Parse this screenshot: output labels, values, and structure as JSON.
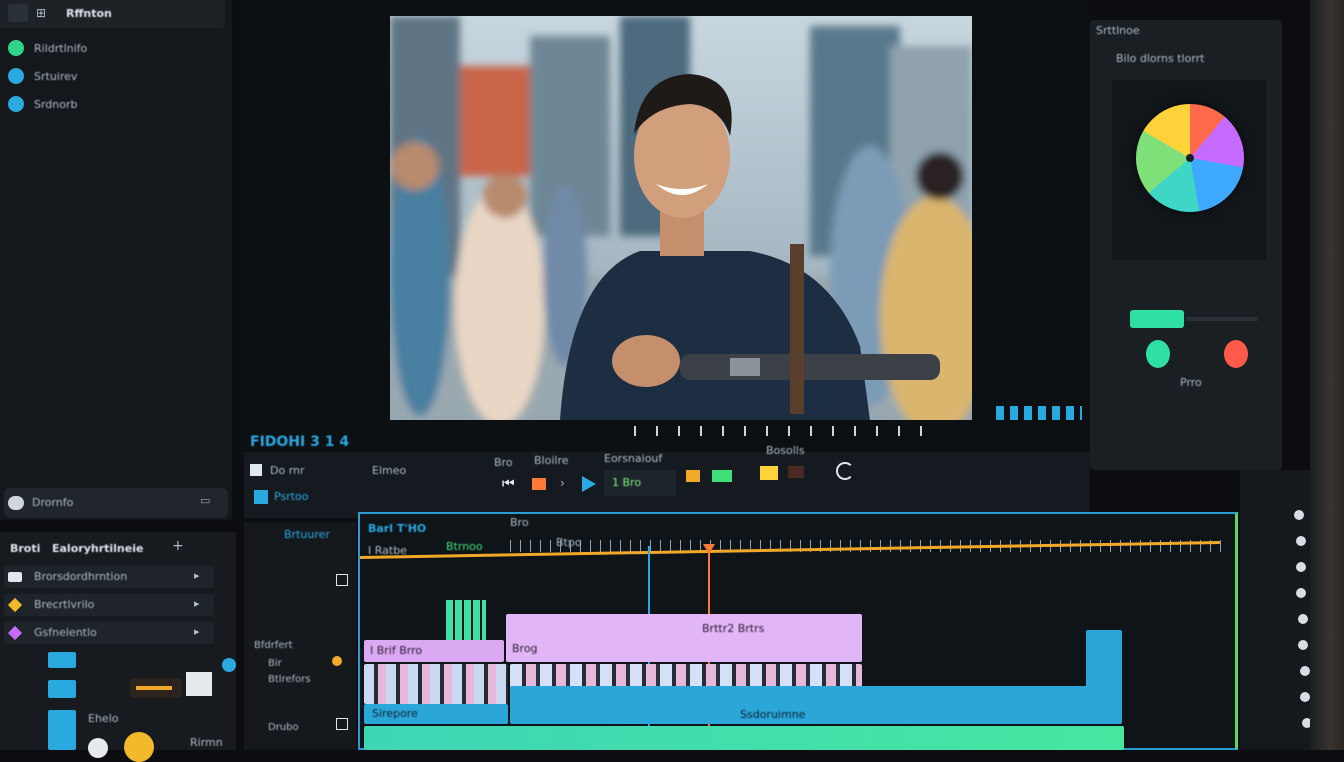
{
  "left_panel": {
    "title": "Rffnton",
    "items": [
      {
        "label": "Rildrtlnifo",
        "color": "#2fd38a"
      },
      {
        "label": "Srtuirev",
        "color": "#2aa8e0"
      },
      {
        "label": "Srdnorb",
        "color": "#2aa8e0"
      }
    ],
    "footer_label": "Drornfo"
  },
  "left_bottom": {
    "header": "Broti",
    "header_title": "Ealoryhrtilneie",
    "rows": [
      "Brorsdordhrntion",
      "Brecrtlvrilo",
      "Gsfnelentlo"
    ],
    "bottom_items": [
      "Ehelo",
      "Rirmn"
    ]
  },
  "viewer": {
    "timecode_label": "FIDOHI 3 1 4",
    "transport_left": [
      "Do rnr",
      "Elmeo",
      "Bro"
    ],
    "transport_mid": [
      "Bloilre",
      "Eorsnaiouf",
      "Bosolls"
    ],
    "play_label": "1 Bro",
    "clip_name": "Psrtoo"
  },
  "timeline": {
    "header_label": "Brtuurer",
    "sequence_label": "Barl T'HO",
    "sequence_tag": "Bro",
    "sub_tag": "Btrnoo",
    "timecode_small": "I Ratbe",
    "playhead_label": "Btpo",
    "clip_labels": [
      "I Brif Brro",
      "Brog",
      "Brttr2 Brtrs",
      "Sirepore",
      "Ssdoruimne"
    ],
    "track_labels": [
      "Bfdrfert",
      "Bir",
      "Btlrefors",
      "Drubo"
    ]
  },
  "color_panel": {
    "title": "Srttlnoe",
    "subtitle": "Bilo dlorns tlorrt",
    "wheel_colors": [
      "#ff6a4a",
      "#c56bff",
      "#3fa8ff",
      "#3fd6c6",
      "#7fe07a",
      "#ffd23a"
    ],
    "slider_label": "Prro",
    "accent_green": "#2fe0a4",
    "accent_red": "#ff5a4a"
  },
  "colors": {
    "accent_blue": "#2b9bd6",
    "accent_green": "#5fd16b",
    "playhead": "#ff7a3a",
    "ruler_line": "#f2a92a"
  }
}
